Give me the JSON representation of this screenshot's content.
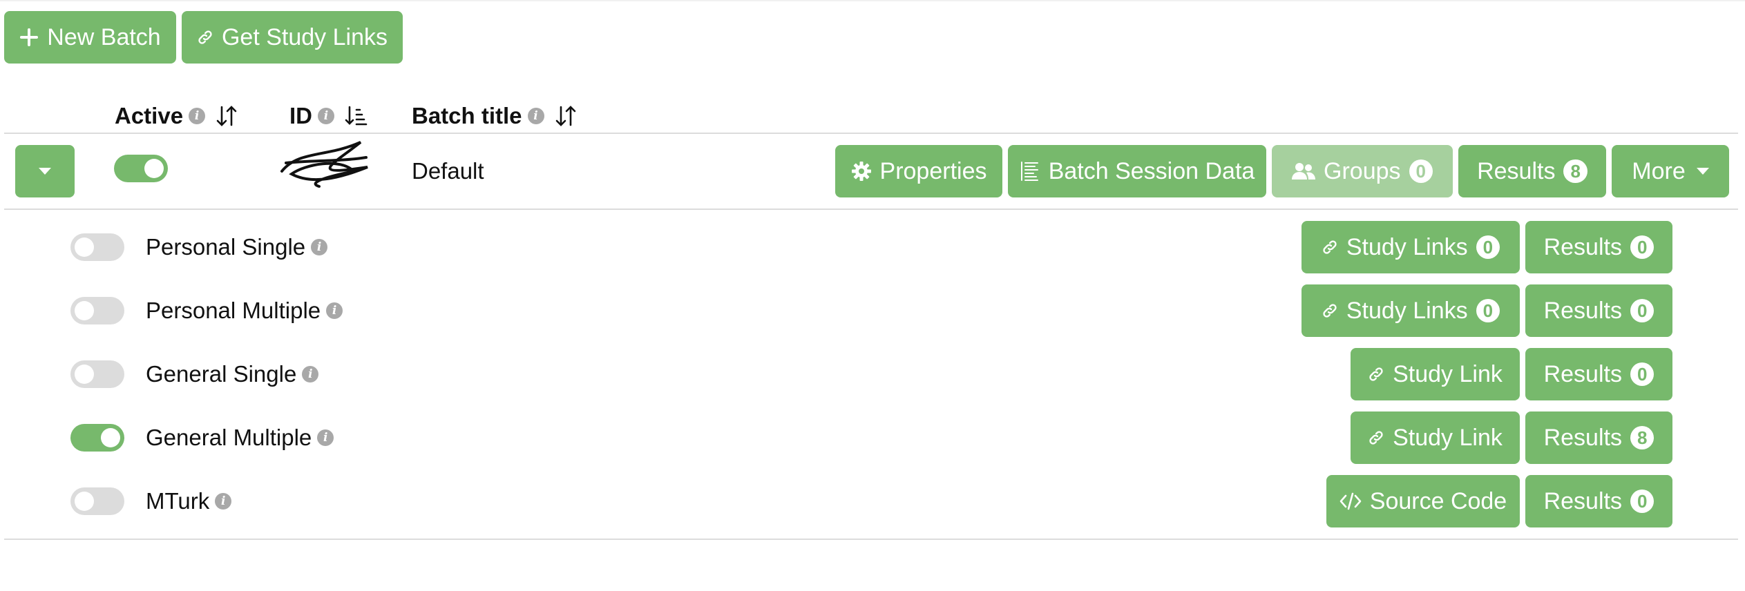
{
  "toolbar": {
    "new_batch_label": "New Batch",
    "get_study_links_label": "Get Study Links"
  },
  "table": {
    "headers": {
      "active": "Active",
      "id": "ID",
      "batch_title": "Batch title"
    },
    "batch": {
      "active": true,
      "title": "Default",
      "buttons": {
        "properties": "Properties",
        "batch_session_data": "Batch Session Data",
        "groups": "Groups",
        "groups_count": "0",
        "results": "Results",
        "results_count": "8",
        "more": "More"
      }
    },
    "study_link_types": [
      {
        "label": "Personal Single",
        "active": false,
        "link_label": "Study Links",
        "link_count": "0",
        "results_label": "Results",
        "results_count": "0"
      },
      {
        "label": "Personal Multiple",
        "active": false,
        "link_label": "Study Links",
        "link_count": "0",
        "results_label": "Results",
        "results_count": "0"
      },
      {
        "label": "General Single",
        "active": false,
        "link_label": "Study Link",
        "results_label": "Results",
        "results_count": "0"
      },
      {
        "label": "General Multiple",
        "active": true,
        "link_label": "Study Link",
        "results_label": "Results",
        "results_count": "8"
      },
      {
        "label": "MTurk",
        "active": false,
        "link_label": "Source Code",
        "results_label": "Results",
        "results_count": "0"
      }
    ]
  },
  "colors": {
    "primary_green": "#77b96c",
    "disabled_green": "#a6d09e",
    "toggle_off": "#dcdcdc",
    "info_icon": "#a8a8a8"
  }
}
